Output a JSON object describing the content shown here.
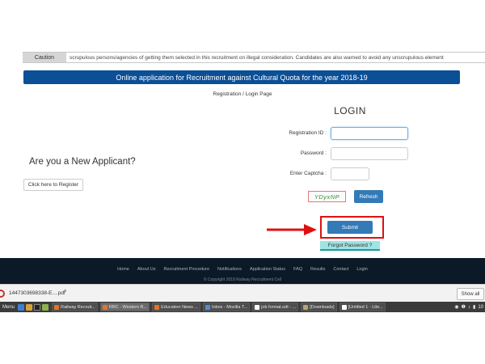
{
  "caution": {
    "label": "Caution",
    "text": "scrupulous persons/agencies of getting them selected in this recruitment on illegal consideration. Candidates are also warned to avoid any unscrupulous element"
  },
  "banner": {
    "text": "Online application for Recruitment against Cultural Quota for the year 2018-19"
  },
  "page_heading": "Registration / Login Page",
  "login": {
    "title": "LOGIN",
    "registration_label": "Registration ID :",
    "password_label": "Password :",
    "captcha_label": "Enter Captcha :",
    "registration_value": "",
    "password_value": "",
    "captcha_value": "",
    "captcha_image_text": "YDyxNP",
    "refresh_label": "Refresh",
    "submit_label": "Submit",
    "forgot_label": "Forgot Password ?"
  },
  "new_applicant": {
    "heading": "Are you a New Applicant?",
    "register_label": "Click here to Register"
  },
  "footer": {
    "nav": [
      "Home",
      "About Us",
      "Recruitment Procedure",
      "Notifications",
      "Application Status",
      "FAQ",
      "Results",
      "Contact",
      "Login"
    ],
    "copyright": "© Copyright 2018 Railway Recruitment Cell"
  },
  "downloads": {
    "file_name": "1447303698338-E....pdf",
    "show_all": "Show all"
  },
  "taskbar": {
    "menu": "Menu",
    "tasks": [
      "Railway Recruit...",
      "RRC - Western R...",
      "Education News ...",
      "Inbox - Mozilla T...",
      "job format.odt - ...",
      "[Downloads]",
      "[Untitled 1 - Libr..."
    ],
    "tray": "10"
  },
  "colors": {
    "banner": "#0b4f96",
    "button_primary": "#337ab7",
    "highlight_frame": "#e01010",
    "footer": "#0c1a27",
    "forgot_button": "#9fe3e3"
  }
}
